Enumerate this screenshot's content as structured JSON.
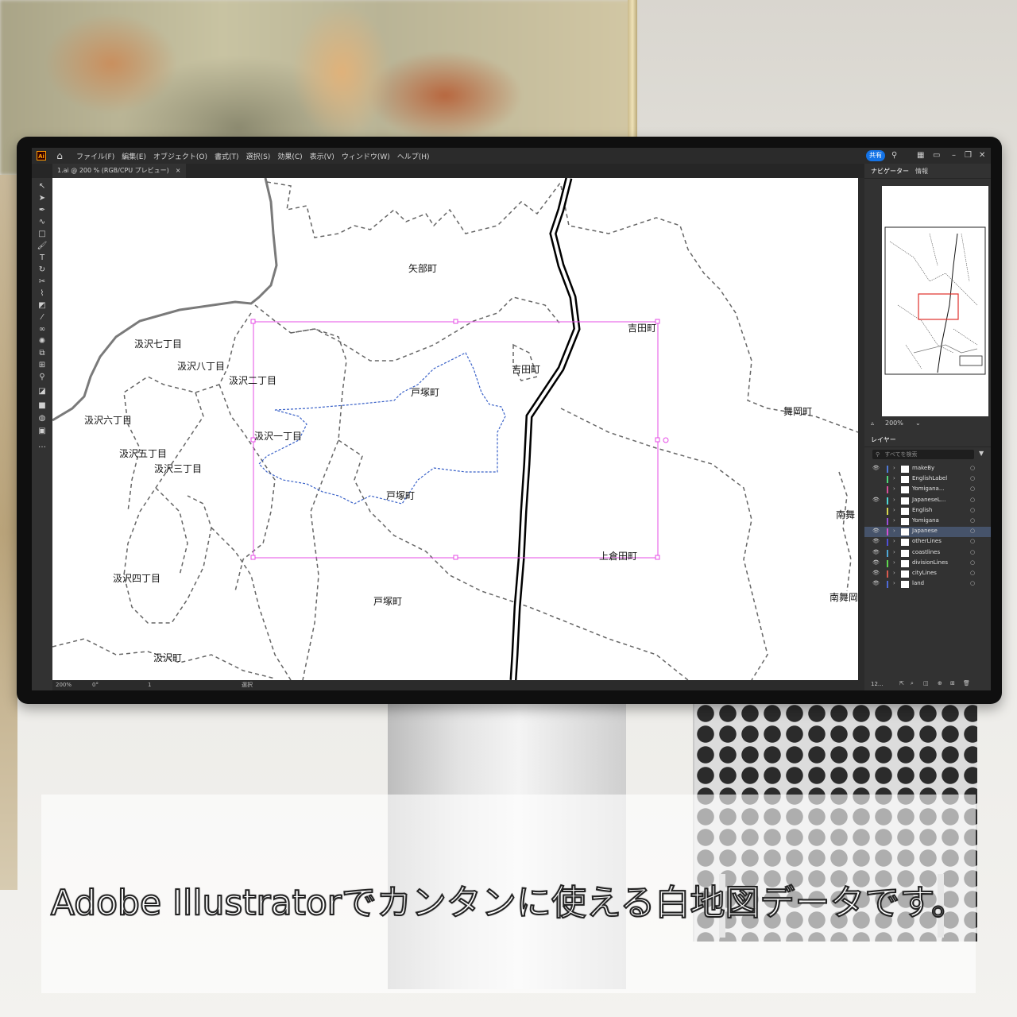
{
  "colors": {
    "accent": "#1473e6",
    "selection": "#e64ce6",
    "path_selection": "#3a62c8",
    "panel_bg": "#323232",
    "canvas_bg": "#ffffff"
  },
  "menubar": {
    "app_icon": "Ai",
    "items": [
      "ファイル(F)",
      "編集(E)",
      "オブジェクト(O)",
      "書式(T)",
      "選択(S)",
      "効果(C)",
      "表示(V)",
      "ウィンドウ(W)",
      "ヘルプ(H)"
    ],
    "share_label": "共有"
  },
  "document_tab": {
    "title": "1.ai @ 200 % (RGB/CPU プレビュー)",
    "close": "×"
  },
  "map_labels": [
    {
      "text": "矢部町"
    },
    {
      "text": "吉田町"
    },
    {
      "text": "吉田町"
    },
    {
      "text": "汲沢七丁目"
    },
    {
      "text": "汲沢八丁目"
    },
    {
      "text": "汲沢二丁目"
    },
    {
      "text": "戸塚町"
    },
    {
      "text": "舞岡町"
    },
    {
      "text": "汲沢六丁目"
    },
    {
      "text": "汲沢一丁目"
    },
    {
      "text": "汲沢五丁目"
    },
    {
      "text": "汲沢三丁目"
    },
    {
      "text": "戸塚町"
    },
    {
      "text": "南舞"
    },
    {
      "text": "上倉田町"
    },
    {
      "text": "汲沢四丁目"
    },
    {
      "text": "戸塚町"
    },
    {
      "text": "南舞岡"
    },
    {
      "text": "汲沢町"
    }
  ],
  "statusbar": {
    "zoom": "200%",
    "rotation": "0°",
    "artboard": "1",
    "tool": "選択"
  },
  "navigator": {
    "tabs": [
      "ナビゲーター",
      "情報"
    ],
    "zoom": "200%"
  },
  "layers": {
    "tab": "レイヤー",
    "search_placeholder": "すべてを検索",
    "items": [
      {
        "name": "makeBy",
        "color": "#4f7ad8",
        "visible": true
      },
      {
        "name": "EnglishLabel",
        "color": "#4fd87a",
        "visible": false
      },
      {
        "name": "Yomigana...",
        "color": "#d84f9a",
        "visible": false
      },
      {
        "name": "JapaneseL...",
        "color": "#4fd8d8",
        "visible": true
      },
      {
        "name": "English",
        "color": "#d8d84f",
        "visible": false
      },
      {
        "name": "Yomigana",
        "color": "#9a4fd8",
        "visible": false
      },
      {
        "name": "Japanese",
        "color": "#d84fd8",
        "visible": true,
        "selected": true
      },
      {
        "name": "otherLines",
        "color": "#4f4fd8",
        "visible": true
      },
      {
        "name": "coastlines",
        "color": "#4fa8d8",
        "visible": true
      },
      {
        "name": "divisionLines",
        "color": "#5fd84f",
        "visible": true
      },
      {
        "name": "cityLines",
        "color": "#d85a4f",
        "visible": true
      },
      {
        "name": "land",
        "color": "#4f6ad8",
        "visible": true
      }
    ],
    "footer_count": "12..."
  },
  "caption": "Adobe Illustratorでカンタンに使える白地図データです。"
}
